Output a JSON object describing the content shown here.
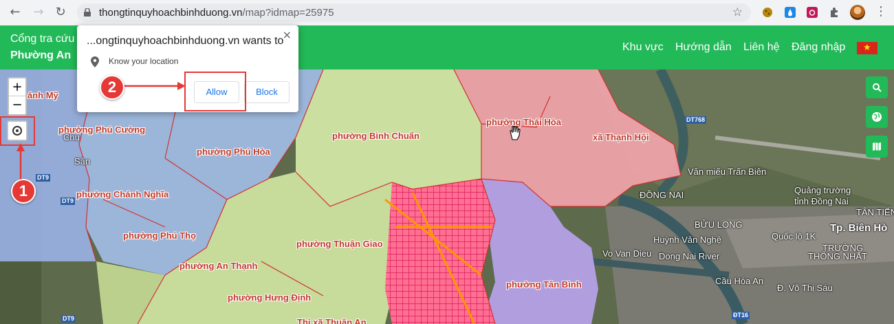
{
  "browser": {
    "url_host": "thongtinquyhoachbinhduong.vn",
    "url_path": "/map?idmap=25975",
    "back_icon": "←",
    "forward_icon": "→",
    "reload_icon": "↻",
    "star_icon": "☆",
    "menu_icon": "⋮"
  },
  "header": {
    "brand_line1": "Cổng tra cứu",
    "brand_line2": "Phường An",
    "menu": [
      "Khu vực",
      "Hướng dẫn",
      "Liên hệ",
      "Đăng nhập"
    ],
    "brand_color": "#22b958"
  },
  "popup": {
    "title": "...ongtinquyhoachbinhduong.vn wants to",
    "close": "×",
    "permission": "Know your location",
    "allow": "Allow",
    "block": "Block"
  },
  "map": {
    "zoom_in": "+",
    "zoom_out": "−",
    "wards": [
      "phường Phú Cường",
      "phường Phú Hòa",
      "phường Bình Chuẩn",
      "phường Thái Hòa",
      "xã Thạnh Hội",
      "phường Chánh Nghĩa",
      "phường Phú Thọ",
      "phường Thuận Giao",
      "phường An Thạnh",
      "phường Tân Bình",
      "phường Hưng Định",
      "Thị xã Thuận An",
      "ánh Mỹ"
    ],
    "places": [
      "Văn miếu Trấn Biên",
      "Quảng trường",
      "tỉnh Đồng Nai",
      "BỬU LONG",
      "Tp. Biên Hò",
      "Huỳnh Văn Nghệ",
      "Dong Nai River",
      "TÂN TIẾN",
      "Quốc lộ 1K",
      "TRƯỜNG",
      "THỐNG NHẤT",
      "ĐỒNG NAI",
      "Sân",
      "Chu",
      "ĐT16",
      "Cầu Hóa An",
      "Đ. Võ Thị Sáu",
      "Vo Van Dieu"
    ],
    "roads": [
      "DT768",
      "DT9",
      "DT9",
      "DT9"
    ]
  },
  "annotations": {
    "step1": "1",
    "step2": "2"
  }
}
